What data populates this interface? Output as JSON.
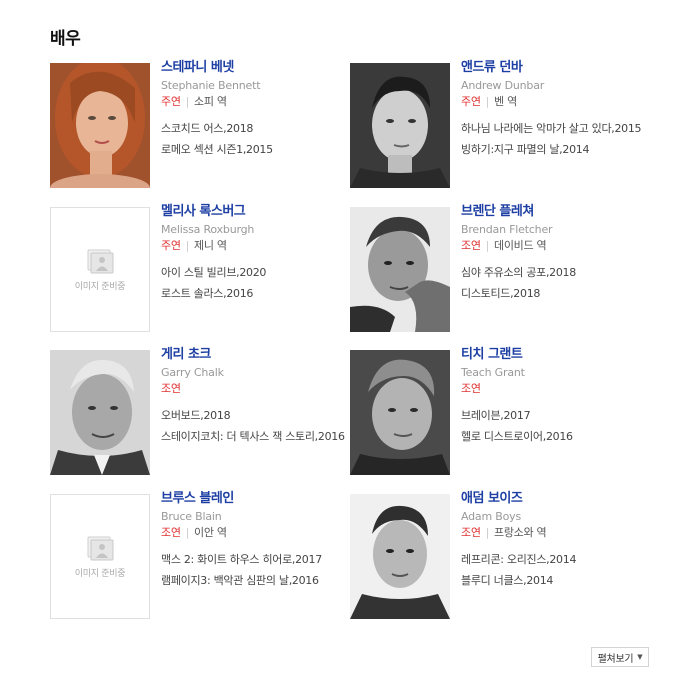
{
  "section": {
    "title": "배우"
  },
  "placeholder_text": "이미지 준비중",
  "more_button": {
    "label": "펼쳐보기",
    "icon": "caret-down-icon"
  },
  "colors": {
    "name": "#1d3fa3",
    "role_type": "#e03131",
    "english_name": "#999999"
  },
  "actors": [
    {
      "name_ko": "스테파니 베넷",
      "name_en": "Stephanie Bennett",
      "role_type": "주연",
      "role_name": "소피 역",
      "photo": "photo",
      "works": [
        "스코치드 어스,2018",
        "로메오 섹션 시즌1,2015"
      ]
    },
    {
      "name_ko": "앤드류 던바",
      "name_en": "Andrew Dunbar",
      "role_type": "주연",
      "role_name": "벤 역",
      "photo": "photo",
      "works": [
        "하나님 나라에는 악마가 살고 있다,2015",
        "빙하기:지구 파멸의 날,2014"
      ]
    },
    {
      "name_ko": "멜리사 록스버그",
      "name_en": "Melissa Roxburgh",
      "role_type": "주연",
      "role_name": "제니 역",
      "photo": "placeholder",
      "works": [
        "아이 스틸 빌리브,2020",
        "로스트 솔라스,2016"
      ]
    },
    {
      "name_ko": "브렌단 플레쳐",
      "name_en": "Brendan Fletcher",
      "role_type": "조연",
      "role_name": "데이비드 역",
      "photo": "photo",
      "works": [
        "심야 주유소의 공포,2018",
        "디스토티드,2018"
      ]
    },
    {
      "name_ko": "게리 초크",
      "name_en": "Garry Chalk",
      "role_type": "조연",
      "role_name": "",
      "photo": "photo",
      "works": [
        "오버보드,2018",
        "스테이지코치: 더 텍사스 잭 스토리,2016"
      ]
    },
    {
      "name_ko": "티치 그랜트",
      "name_en": "Teach Grant",
      "role_type": "조연",
      "role_name": "",
      "photo": "photo",
      "works": [
        "브레이븐,2017",
        "헬로 디스트로이어,2016"
      ]
    },
    {
      "name_ko": "브루스 블레인",
      "name_en": "Bruce Blain",
      "role_type": "조연",
      "role_name": "이안 역",
      "photo": "placeholder",
      "works": [
        "맥스 2: 화이트 하우스 히어로,2017",
        "램페이지3: 백악관 심판의 날,2016"
      ]
    },
    {
      "name_ko": "애덤 보이즈",
      "name_en": "Adam Boys",
      "role_type": "조연",
      "role_name": "프랑소와 역",
      "photo": "photo",
      "works": [
        "레프리콘: 오리진스,2014",
        "블루디 너클스,2014"
      ]
    }
  ]
}
